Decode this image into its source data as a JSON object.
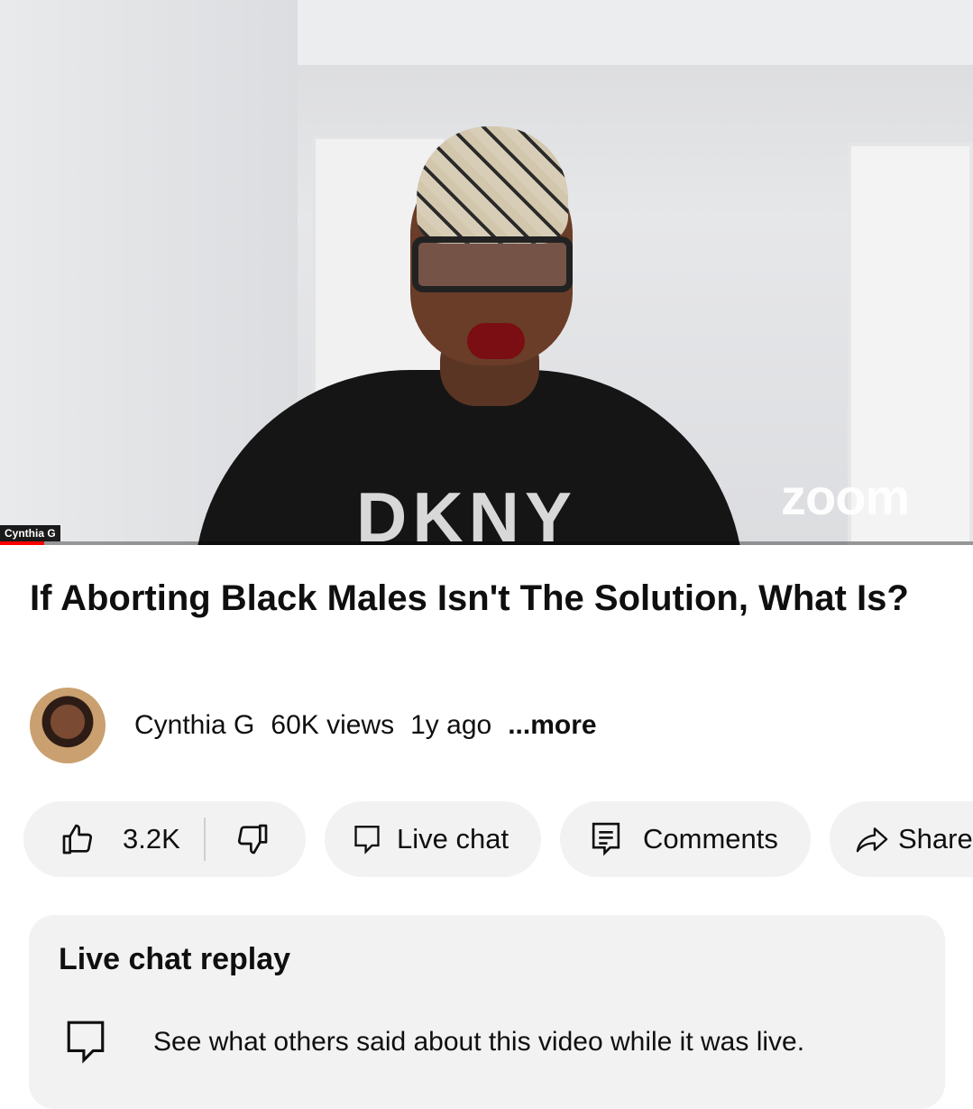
{
  "video": {
    "overlay_name": "Cynthia G",
    "watermark": "zoom",
    "shirt_text": "DKNY",
    "progress_fraction": 0.045
  },
  "title": "If Aborting Black Males Isn't The Solution, What Is?",
  "meta": {
    "channel": "Cynthia G",
    "views": "60K views",
    "age": "1y ago",
    "more": "...more"
  },
  "actions": {
    "likes": "3.2K",
    "live_chat": "Live chat",
    "comments": "Comments",
    "share": "Share"
  },
  "chat_card": {
    "heading": "Live chat replay",
    "description": "See what others said about this video while it was live."
  },
  "icons": {
    "like": "thumbs-up-icon",
    "dislike": "thumbs-down-icon",
    "live_chat": "chat-bubble-icon",
    "comments": "comment-icon",
    "share": "share-arrow-icon"
  }
}
